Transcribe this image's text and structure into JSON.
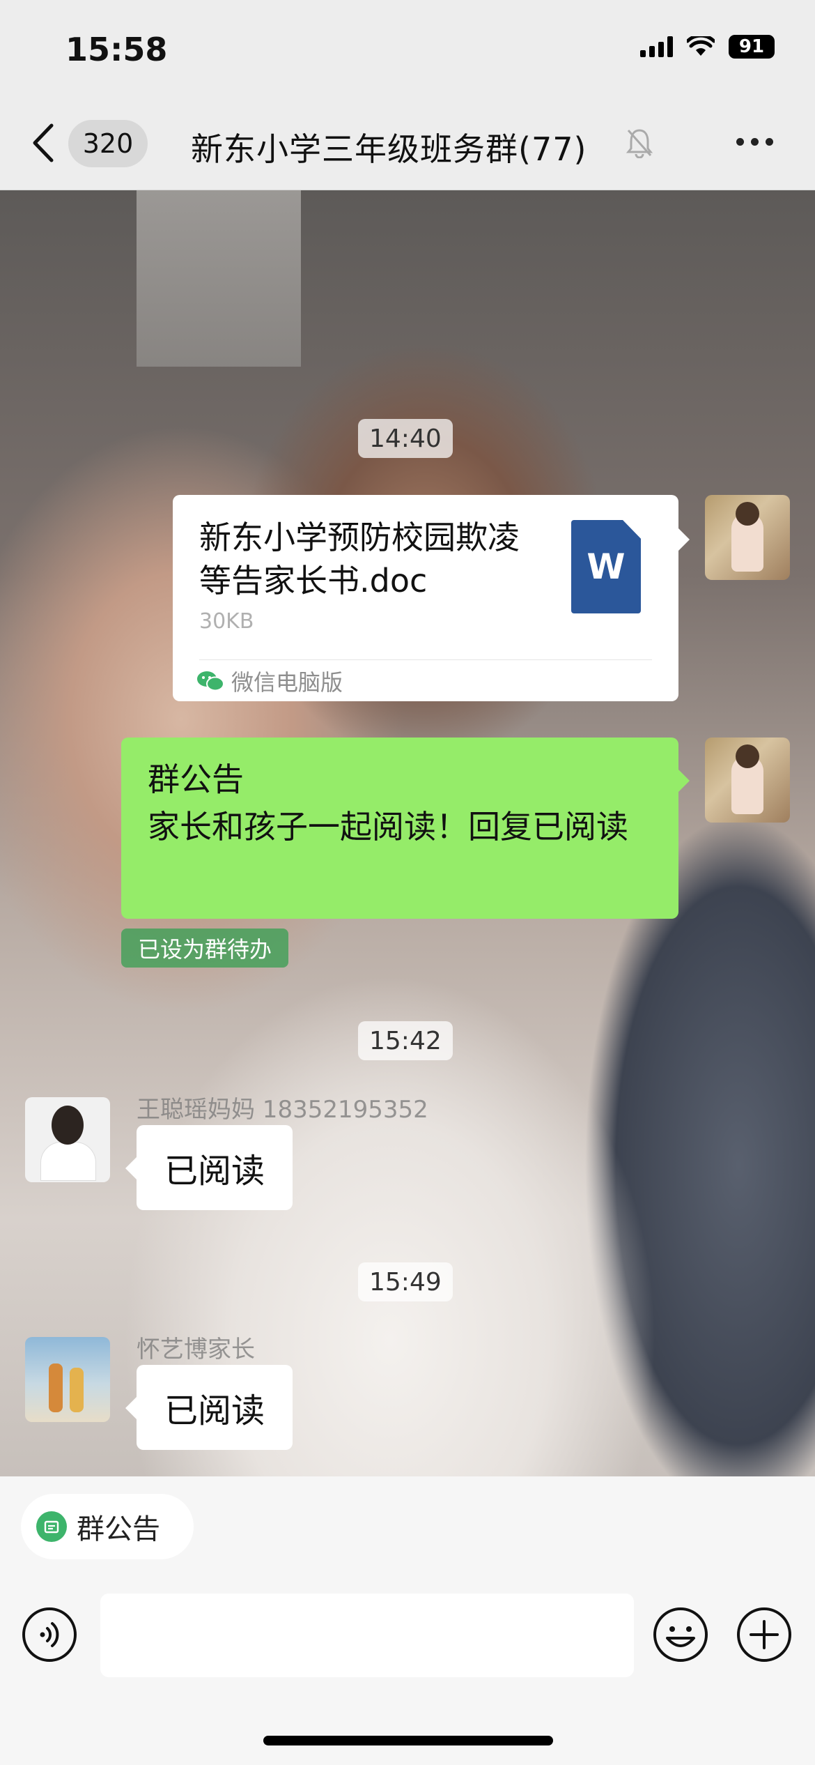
{
  "status_bar": {
    "time": "15:58",
    "battery": "91"
  },
  "header": {
    "unread_count": "320",
    "title": "新东小学三年级班务群(77)"
  },
  "messages": {
    "ts1": "14:40",
    "file": {
      "name": "新东小学预防校园欺凌等告家长书.doc",
      "size": "30KB",
      "type_letter": "W",
      "source": "微信电脑版"
    },
    "announcement": {
      "text": "群公告\n家长和孩子一起阅读！回复已阅读",
      "tag": "已设为群待办"
    },
    "ts2": "15:42",
    "reply1": {
      "sender": "王聪瑶妈妈 18352195352",
      "text": "已阅读"
    },
    "ts3": "15:49",
    "reply2": {
      "sender": "怀艺博家长",
      "text": "已阅读"
    }
  },
  "bottom": {
    "notice_chip": "群公告"
  },
  "colors": {
    "self_bubble": "#95ec69",
    "word_blue": "#2b579a",
    "wechat_green": "#3db46b"
  }
}
